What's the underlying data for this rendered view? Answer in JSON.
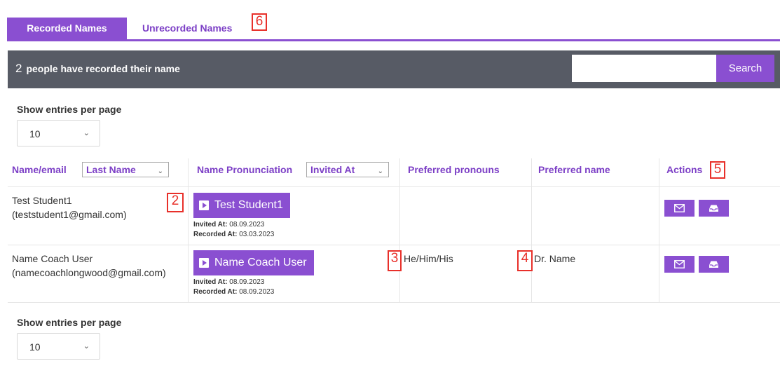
{
  "tabs": [
    {
      "label": "Recorded Names",
      "active": true
    },
    {
      "label": "Unrecorded Names",
      "active": false
    }
  ],
  "markers": {
    "m2": "2",
    "m3": "3",
    "m4": "4",
    "m5": "5",
    "m6": "6"
  },
  "header": {
    "count": "2",
    "text": "people have recorded their name",
    "search_placeholder": "",
    "search_label": "Search"
  },
  "entries_top": {
    "label": "Show entries per page",
    "value": "10"
  },
  "entries_bottom": {
    "label": "Show entries per page",
    "value": "10"
  },
  "columns": {
    "name_email": "Name/email",
    "name_sort": "Last Name",
    "pronunciation": "Name Pronunciation",
    "pronunciation_sort": "Invited At",
    "pronouns": "Preferred pronouns",
    "preferred_name": "Preferred name",
    "actions": "Actions"
  },
  "rows": [
    {
      "name": "Test Student1",
      "email": "(teststudent1@gmail.com)",
      "play_label": "Test Student1",
      "invited_label": "Invited At:",
      "invited_at": "08.09.2023",
      "recorded_label": "Recorded At:",
      "recorded_at": "03.03.2023",
      "pronouns": "",
      "preferred_name": ""
    },
    {
      "name": "Name Coach User",
      "email": "(namecoachlongwood@gmail.com)",
      "play_label": "Name Coach User",
      "invited_label": "Invited At:",
      "invited_at": "08.09.2023",
      "recorded_label": "Recorded At:",
      "recorded_at": "08.09.2023",
      "pronouns": "He/Him/His",
      "preferred_name": "Dr. Name"
    }
  ],
  "icons": {
    "play": "play-icon",
    "email": "envelope-icon",
    "inbox": "inbox-icon",
    "chevron": "chevron-down-icon"
  },
  "colors": {
    "accent": "#8a4fd1",
    "header_bg": "#575b65",
    "marker": "#e8302a"
  }
}
